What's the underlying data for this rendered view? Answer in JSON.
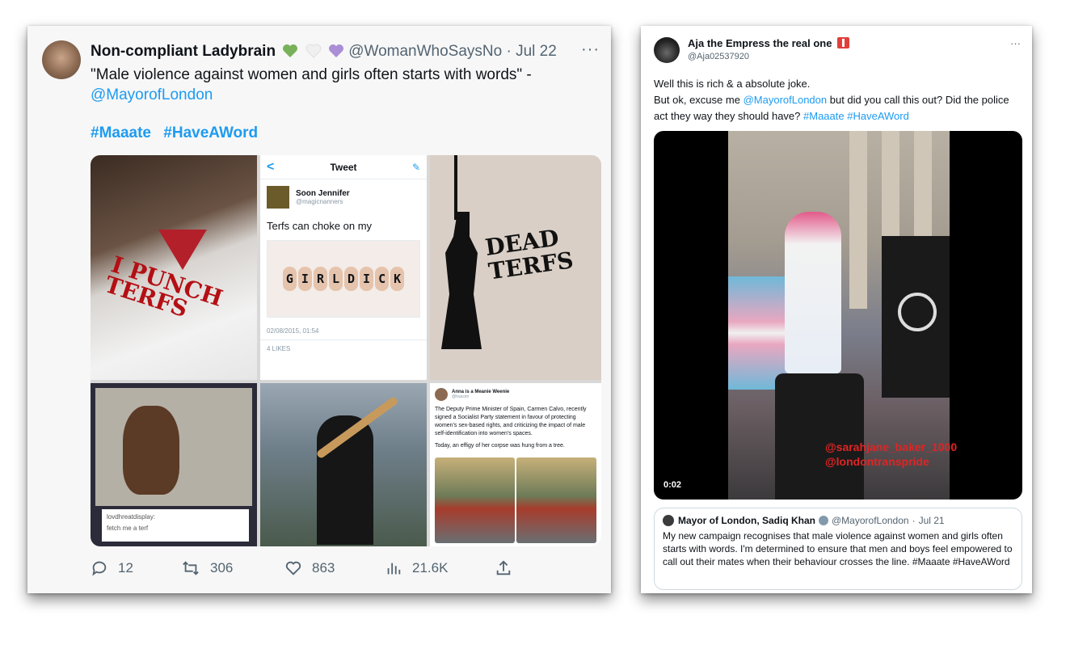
{
  "left_tweet": {
    "display_name": "Non-compliant Ladybrain",
    "hearts": [
      "green",
      "white",
      "purple"
    ],
    "handle": "@WomanWhoSaysNo",
    "separator": "·",
    "date": "Jul 22",
    "more": "···",
    "text_quote": "\"Male violence against women and girls often starts with words\" -",
    "text_mention": "@MayorofLondon",
    "hashtags": [
      "#Maaate",
      "#HaveAWord"
    ],
    "embedded_tweet": {
      "header": "Tweet",
      "back": "<",
      "name": "Soon Jennifer",
      "handle": "@magicnanners",
      "body": "Terfs can choke on my",
      "fists_text": [
        "G",
        "I",
        "R",
        "L",
        "D",
        "I",
        "C",
        "K"
      ],
      "date": "02/08/2015, 01:54",
      "likes": "4 LIKES"
    },
    "image_texts": {
      "shirt": "I PUNCH TERFS",
      "poster": "DEAD TERFS",
      "tumblr_user": "lovdhreatdisplay:",
      "tumblr_text": "fetch me a terf"
    },
    "embedded_post": {
      "name": "Anna is a Meanie Weenie",
      "handle": "@Ivacom",
      "body1": "The Deputy Prime Minister of Spain, Carmen Calvo, recently signed a Socialist Party statement in favour of protecting women's sex-based rights, and criticizing the impact of male self-identification into women's spaces.",
      "body2": "Today, an effigy of her corpse was hung from a tree."
    },
    "actions": {
      "replies": "12",
      "retweets": "306",
      "likes": "863",
      "views": "21.6K"
    }
  },
  "right_tweet": {
    "display_name": "Aja the Empress the real one",
    "handle": "@Aja02537920",
    "more": "···",
    "text_line1": "Well this is rich & a absolute joke.",
    "text_line2_pre": "But ok, excuse me",
    "text_mention": "@MayorofLondon",
    "text_line2_post": "but did you call this out? Did the police act they way they should have?",
    "hashtags": [
      "#Maaate",
      "#HaveAWord"
    ],
    "video": {
      "timestamp": "0:02",
      "overlay_line1": "@sarahjane_baker_1000",
      "overlay_line2": "@londontranspride"
    },
    "quoted": {
      "name": "Mayor of London, Sadiq Khan",
      "handle": "@MayorofLondon",
      "separator": "·",
      "date": "Jul 21",
      "text": "My new campaign recognises that male violence against women and girls often starts with words. I'm determined to ensure that men and boys feel empowered to call out their mates when their behaviour crosses the line. #Maaate #HaveAWord"
    }
  },
  "colors": {
    "link": "#1d9bf0",
    "muted": "#536471",
    "heart_green": "#78b159",
    "heart_white": "#f0f0f0",
    "heart_purple": "#aa8ed6"
  }
}
